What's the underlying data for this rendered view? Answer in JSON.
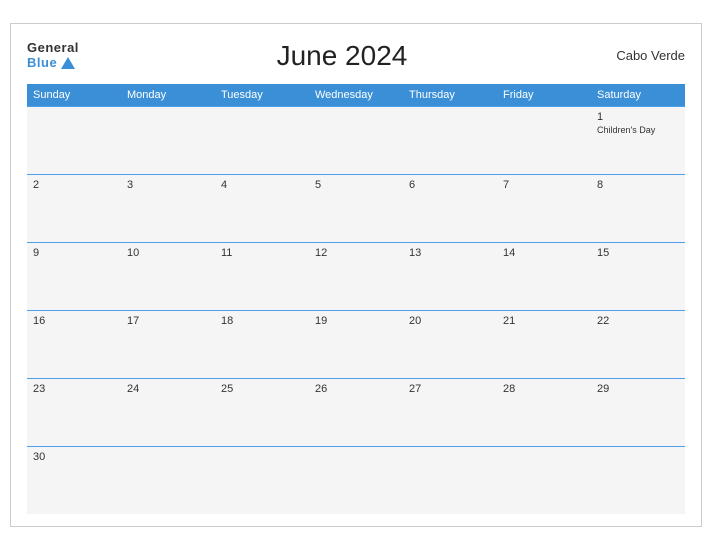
{
  "header": {
    "logo_general": "General",
    "logo_blue": "Blue",
    "title": "June 2024",
    "country": "Cabo Verde"
  },
  "weekdays": [
    "Sunday",
    "Monday",
    "Tuesday",
    "Wednesday",
    "Thursday",
    "Friday",
    "Saturday"
  ],
  "weeks": [
    [
      {
        "day": "",
        "empty": true
      },
      {
        "day": "",
        "empty": true
      },
      {
        "day": "",
        "empty": true
      },
      {
        "day": "",
        "empty": true
      },
      {
        "day": "",
        "empty": true
      },
      {
        "day": "",
        "empty": true
      },
      {
        "day": "1",
        "holiday": "Children's Day"
      }
    ],
    [
      {
        "day": "2"
      },
      {
        "day": "3"
      },
      {
        "day": "4"
      },
      {
        "day": "5"
      },
      {
        "day": "6"
      },
      {
        "day": "7"
      },
      {
        "day": "8"
      }
    ],
    [
      {
        "day": "9"
      },
      {
        "day": "10"
      },
      {
        "day": "11"
      },
      {
        "day": "12"
      },
      {
        "day": "13"
      },
      {
        "day": "14"
      },
      {
        "day": "15"
      }
    ],
    [
      {
        "day": "16"
      },
      {
        "day": "17"
      },
      {
        "day": "18"
      },
      {
        "day": "19"
      },
      {
        "day": "20"
      },
      {
        "day": "21"
      },
      {
        "day": "22"
      }
    ],
    [
      {
        "day": "23"
      },
      {
        "day": "24"
      },
      {
        "day": "25"
      },
      {
        "day": "26"
      },
      {
        "day": "27"
      },
      {
        "day": "28"
      },
      {
        "day": "29"
      }
    ],
    [
      {
        "day": "30"
      },
      {
        "day": "",
        "empty": true
      },
      {
        "day": "",
        "empty": true
      },
      {
        "day": "",
        "empty": true
      },
      {
        "day": "",
        "empty": true
      },
      {
        "day": "",
        "empty": true
      },
      {
        "day": "",
        "empty": true
      }
    ]
  ]
}
